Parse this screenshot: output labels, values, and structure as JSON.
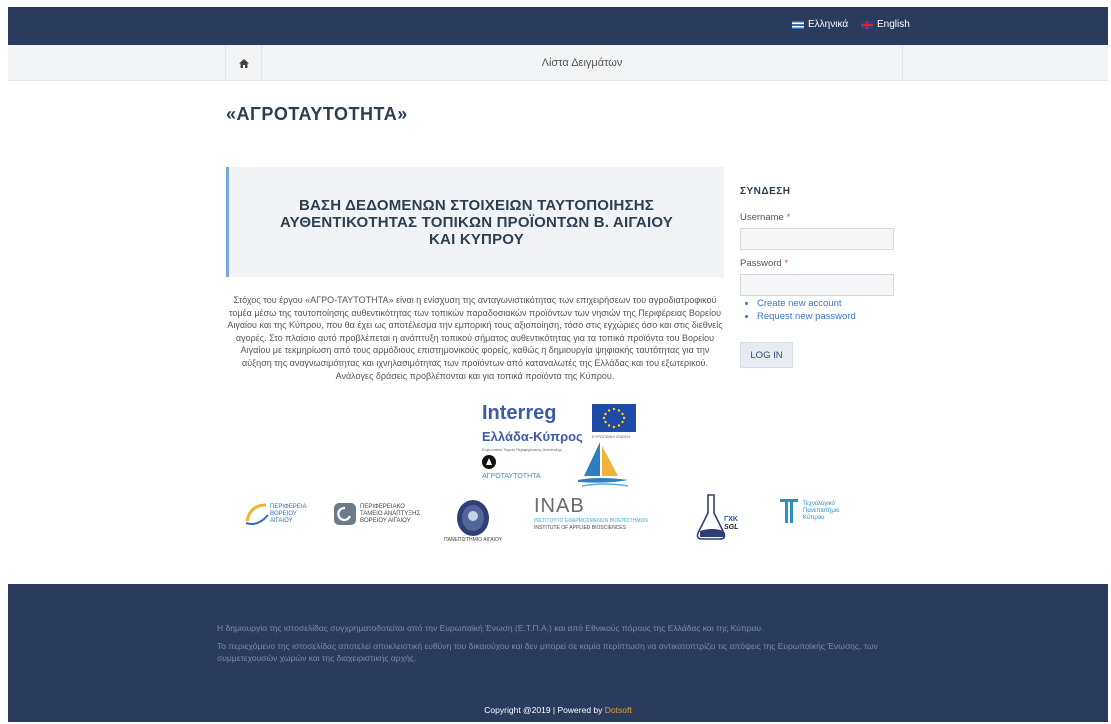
{
  "topbar": {
    "lang_gr": "Ελληνικά",
    "lang_en": "English"
  },
  "nav": {
    "home_icon": "home-icon",
    "link": "Λίστα Δειγμάτων"
  },
  "page": {
    "title": "«ΑΓΡΟΤΑΥΤΟΤΗΤΑ»"
  },
  "hero": {
    "line1": "ΒΑΣΗ ΔΕΔΟΜΕΝΩΝ ΣΤΟΙΧΕΙΩΝ ΤΑΥΤΟΠΟΙΗΣΗΣ",
    "line2": "ΑΥΘΕΝΤΙΚΟΤΗΤΑΣ ΤΟΠΙΚΩΝ ΠΡΟΪΟΝΤΩΝ Β. ΑΙΓΑΙΟΥ",
    "line3": "ΚΑΙ ΚΥΠΡΟΥ"
  },
  "intro": "Στόχος του έργου «ΑΓΡΟ-ΤΑΥΤΟΤΗΤΑ» είναι η ενίσχυση της ανταγωνιστικότητας των επιχειρήσεων του αγροδιατροφικού τομέα μέσω της ταυτοποίησης αυθεντικότητας των τοπικών παραδοσιακών προϊόντων των νησιών της Περιφέρειας Βορείου Αιγαίου και της Κύπρου, που θα έχει ως αποτέλεσμα την εμπορική τους αξιοποίηση, τόσο στις εγχώριες όσο και στις διεθνείς αγορές. Στο πλαίσιο αυτό προβλέπεται η ανάπτυξη τοπικού σήματος αυθεντικότητας για τα τοπικά προϊόντα του Βορείου Αιγαίου με τεκμηρίωση από τους αρμόδιους επιστημονικούς φορείς, καθώς η δημιουργία ψηφιακής ταυτότητας για την αύξηση της αναγνωσιμότητας και ιχνηλασιμότητας των προϊόντων από καταναλωτές της Ελλάδας και του εξωτερικού. Ανάλογες δράσεις προβλέπονται και για τοπικά προϊόντα της Κύπρου.",
  "logos": {
    "interreg": "Interreg",
    "interreg_sub": "Ελλάδα-Κύπρος",
    "interreg_small": "Ευρωπαϊκό Ταμείο Περιφερειακής Ανάπτυξης",
    "eu_caption": "ΕΥΡΩΠΑΪΚΗ ΕΝΩΣΗ",
    "agro": "ΑΓΡΟΤΑΥΤΟΤΗΤΑ"
  },
  "partners": {
    "p1": [
      "ΠΕΡΙΦΕΡΕΙΑ",
      "ΒΟΡΕΙΟΥ",
      "ΑΙΓΑΙΟΥ"
    ],
    "p2": [
      "ΠΕΡΙΦΕΡΕΙΑΚΟ",
      "ΤΑΜΕΙΟ ΑΝΑΠΤΥΞΗΣ",
      "ΒΟΡΕΙΟΥ ΑΙΓΑΙΟΥ"
    ],
    "p3": "ΠΑΝΕΠΙΣΤΗΜΙΟ ΑΙΓΑΙΟΥ",
    "p4_name": "INAB",
    "p4_line1": "ΙΝΣΤΙΤΟΥΤΟ ΕΦΑΡΜΟΣΜΕΝΩΝ ΒΙΟΕΠΙΣΤΗΜΩΝ",
    "p4_line2": "INSTITUTE OF APPLIED BIOSCIENCES",
    "p5_top": "ΓΧΚ",
    "p5_bottom": "SGL",
    "p6": [
      "Τεχνολογικό",
      "Πανεπιστήμιο",
      "Κύπρου"
    ]
  },
  "login": {
    "title": "ΣΥΝΔΕΣΗ",
    "username_label": "Username",
    "password_label": "Password",
    "required_mark": "*",
    "create_account": "Create new account",
    "request_password": "Request new password",
    "button": "LOG IN"
  },
  "footer": {
    "line1": "Η δημιουργία της ιστοσελίδας συγχρηματοδοτείται από την Ευρωπαϊκή Ένωση (Ε.Τ.Π.Α.) και από Εθνικούς πόρους της Ελλάδας και της Κύπρου.",
    "line2": "Το περιεχόμενο της ιστοσελίδας αποτελεί αποκλειστική ευθύνη του δικαιούχου και δεν μπορεί σε καμία περίπτωση να αντικατοπτρίζει τις απόψεις της Ευρωπαϊκής Ένωσης, των συμμετεχουσών χωρών και της διαχειριστικής αρχής.",
    "copyright": "Copyright @2019  |  Powered by ",
    "brand": "Dotsoft"
  },
  "colors": {
    "header_bg": "#2a3b5e",
    "accent": "#3a76c3",
    "brand_orange": "#e89b3c"
  }
}
